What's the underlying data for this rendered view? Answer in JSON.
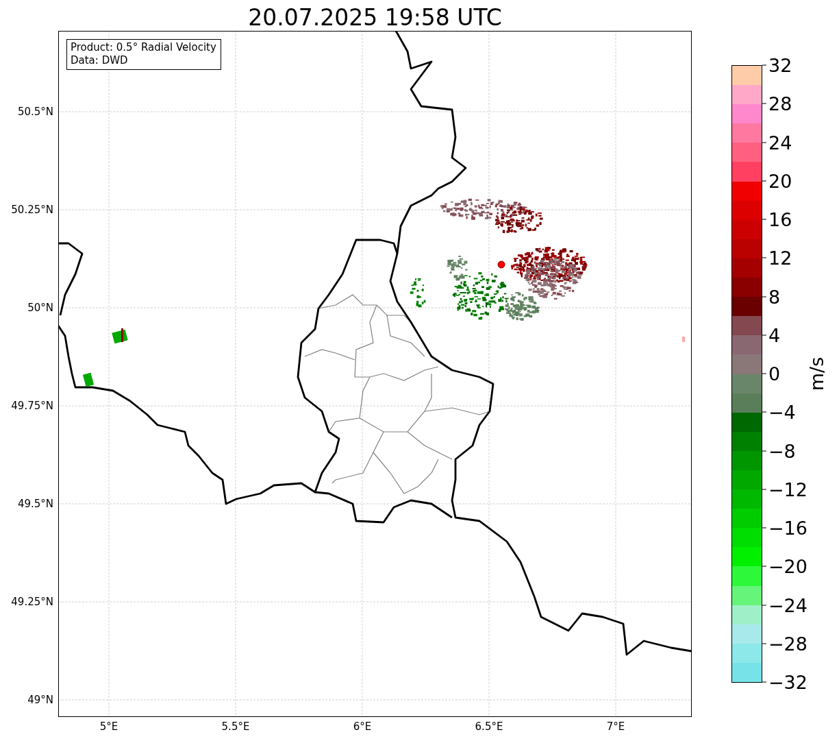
{
  "title": "20.07.2025 19:58 UTC",
  "legend": [
    "Product: 0.5° Radial Velocity",
    "Data: DWD"
  ],
  "lat_ticks": [
    "50.5°N",
    "50.25°N",
    "50°N",
    "49.75°N",
    "49.5°N",
    "49.25°N",
    "49°N"
  ],
  "lon_ticks": [
    "5°E",
    "5.5°E",
    "6°E",
    "6.5°E",
    "7°E"
  ],
  "colorbar": {
    "label": "m/s",
    "ticks": [
      "32",
      "28",
      "24",
      "20",
      "16",
      "12",
      "8",
      "4",
      "0",
      "−4",
      "−8",
      "−12",
      "−16",
      "−20",
      "−24",
      "−28",
      "−32"
    ],
    "segments": [
      {
        "color": "#77e3e8"
      },
      {
        "color": "#8de8ea"
      },
      {
        "color": "#a8eaeb"
      },
      {
        "color": "#9ff0c8"
      },
      {
        "color": "#66f57a"
      },
      {
        "color": "#2ef83a"
      },
      {
        "color": "#00f000"
      },
      {
        "color": "#00dd00"
      },
      {
        "color": "#00cc00"
      },
      {
        "color": "#00b800"
      },
      {
        "color": "#00a800"
      },
      {
        "color": "#009600"
      },
      {
        "color": "#008000"
      },
      {
        "color": "#006800"
      },
      {
        "color": "#5a7e5a"
      },
      {
        "color": "#6a866a"
      },
      {
        "color": "#8a7878"
      },
      {
        "color": "#8a6872"
      },
      {
        "color": "#844850"
      },
      {
        "color": "#6a0000"
      },
      {
        "color": "#8a0000"
      },
      {
        "color": "#a50000"
      },
      {
        "color": "#bb0000"
      },
      {
        "color": "#cc0000"
      },
      {
        "color": "#dd0000"
      },
      {
        "color": "#f00000"
      },
      {
        "color": "#ff4060"
      },
      {
        "color": "#ff6080"
      },
      {
        "color": "#ff78a0"
      },
      {
        "color": "#ff88cc"
      },
      {
        "color": "#ffa8c8"
      },
      {
        "color": "#ffccaa"
      }
    ]
  }
}
